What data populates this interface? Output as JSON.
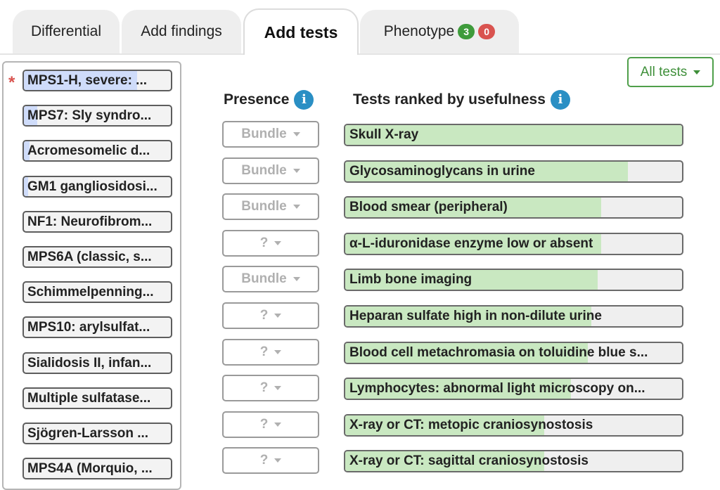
{
  "tabs": [
    {
      "label": "Differential"
    },
    {
      "label": "Add findings"
    },
    {
      "label": "Add tests",
      "active": true
    },
    {
      "label": "Phenotype",
      "badge_green": "3",
      "badge_red": "0"
    }
  ],
  "filter": {
    "label": "All tests"
  },
  "columns": {
    "presence": "Presence",
    "tests": "Tests ranked by usefulness",
    "info_glyph": "i"
  },
  "marker": "*",
  "diagnoses": [
    {
      "label": "MPS1-H, severe: ...",
      "fill_fraction": 0.77
    },
    {
      "label": "MPS7: Sly syndro...",
      "fill_fraction": 0.09
    },
    {
      "label": "Acromesomelic d...",
      "fill_fraction": 0.04
    },
    {
      "label": "GM1 gangliosidosi...",
      "fill_fraction": 0.03
    },
    {
      "label": "NF1: Neurofibrom...",
      "fill_fraction": 0.0
    },
    {
      "label": "MPS6A (classic, s...",
      "fill_fraction": 0.0
    },
    {
      "label": "Schimmelpenning...",
      "fill_fraction": 0.0
    },
    {
      "label": "MPS10: arylsulfat...",
      "fill_fraction": 0.0
    },
    {
      "label": "Sialidosis II, infan...",
      "fill_fraction": 0.0
    },
    {
      "label": "Multiple sulfatase...",
      "fill_fraction": 0.0
    },
    {
      "label": "Sjögren-Larsson ...",
      "fill_fraction": 0.0
    },
    {
      "label": "MPS4A (Morquio, ...",
      "fill_fraction": 0.0
    }
  ],
  "tests": [
    {
      "presence": "Bundle",
      "label": "Skull X-ray",
      "usefulness": 1.0
    },
    {
      "presence": "Bundle",
      "label": "Glycosaminoglycans in urine",
      "usefulness": 0.84
    },
    {
      "presence": "Bundle",
      "label": "Blood smear (peripheral)",
      "usefulness": 0.76
    },
    {
      "presence": "?",
      "label": "α-L-iduronidase enzyme low or absent",
      "usefulness": 0.76
    },
    {
      "presence": "Bundle",
      "label": "Limb bone imaging",
      "usefulness": 0.75
    },
    {
      "presence": "?",
      "label": "Heparan sulfate high in non-dilute urine",
      "usefulness": 0.73
    },
    {
      "presence": "?",
      "label": "Blood cell metachromasia on toluidine blue s...",
      "usefulness": 0.72
    },
    {
      "presence": "?",
      "label": "Lymphocytes: abnormal light microscopy on...",
      "usefulness": 0.67
    },
    {
      "presence": "?",
      "label": "X-ray or CT: metopic craniosynostosis",
      "usefulness": 0.59
    },
    {
      "presence": "?",
      "label": "X-ray or CT: sagittal craniosynostosis",
      "usefulness": 0.59
    }
  ],
  "colors": {
    "accent_green": "#4f9f4a",
    "fill_green": "#c9e8c1",
    "fill_blue": "#cfdcfa",
    "info_blue": "#2a8fc4",
    "danger_red": "#d9534f"
  }
}
